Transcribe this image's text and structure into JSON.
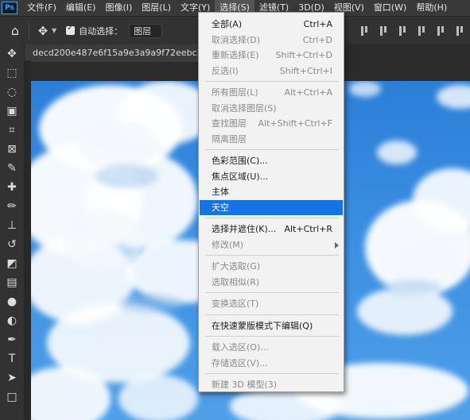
{
  "app": {
    "logo_text": "Ps"
  },
  "menubar": [
    {
      "label": "文件(F)"
    },
    {
      "label": "编辑(E)"
    },
    {
      "label": "图像(I)"
    },
    {
      "label": "图层(L)"
    },
    {
      "label": "文字(Y)"
    },
    {
      "label": "选择(S)"
    },
    {
      "label": "滤镜(T)"
    },
    {
      "label": "3D(D)"
    },
    {
      "label": "视图(V)"
    },
    {
      "label": "窗口(W)"
    },
    {
      "label": "帮助(H)"
    }
  ],
  "options": {
    "auto_select_label": "自动选择：",
    "auto_select_checked": true,
    "auto_select_target": "图层"
  },
  "document": {
    "tab_title": "decd200e487e6f15a9e3a9a9f72eebc5.jpg"
  },
  "select_menu": {
    "items": [
      {
        "label": "全部(A)",
        "shortcut": "Ctrl+A",
        "enabled": true
      },
      {
        "label": "取消选择(D)",
        "shortcut": "Ctrl+D",
        "enabled": false
      },
      {
        "label": "重新选择(E)",
        "shortcut": "Shift+Ctrl+D",
        "enabled": false
      },
      {
        "label": "反选(I)",
        "shortcut": "Shift+Ctrl+I",
        "enabled": false
      },
      {
        "label": "所有图层(L)",
        "shortcut": "Alt+Ctrl+A",
        "enabled": false
      },
      {
        "label": "取消选择图层(S)",
        "shortcut": "",
        "enabled": false
      },
      {
        "label": "查找图层",
        "shortcut": "Alt+Shift+Ctrl+F",
        "enabled": false
      },
      {
        "label": "隔离图层",
        "shortcut": "",
        "enabled": false
      },
      {
        "label": "色彩范围(C)...",
        "shortcut": "",
        "enabled": true
      },
      {
        "label": "焦点区域(U)...",
        "shortcut": "",
        "enabled": true
      },
      {
        "label": "主体",
        "shortcut": "",
        "enabled": true
      },
      {
        "label": "天空",
        "shortcut": "",
        "enabled": true,
        "highlighted": true
      },
      {
        "label": "选择并遮住(K)...",
        "shortcut": "Alt+Ctrl+R",
        "enabled": true
      },
      {
        "label": "修改(M)",
        "shortcut": "",
        "enabled": false,
        "submenu": true
      },
      {
        "label": "扩大选取(G)",
        "shortcut": "",
        "enabled": false
      },
      {
        "label": "选取相似(R)",
        "shortcut": "",
        "enabled": false
      },
      {
        "label": "变换选区(T)",
        "shortcut": "",
        "enabled": false
      },
      {
        "label": "在快速蒙版模式下编辑(Q)",
        "shortcut": "",
        "enabled": true
      },
      {
        "label": "载入选区(O)...",
        "shortcut": "",
        "enabled": false
      },
      {
        "label": "存储选区(V)...",
        "shortcut": "",
        "enabled": false
      },
      {
        "label": "新建 3D 模型(3)",
        "shortcut": "",
        "enabled": false
      }
    ]
  },
  "colors": {
    "menu_highlight": "#1473e6",
    "sky": "#3b8fe2",
    "app_bg": "#2b2b2b"
  },
  "tools": [
    {
      "name": "move-tool-icon"
    },
    {
      "name": "marquee-tool-icon"
    },
    {
      "name": "lasso-tool-icon"
    },
    {
      "name": "object-select-tool-icon"
    },
    {
      "name": "crop-tool-icon"
    },
    {
      "name": "frame-tool-icon"
    },
    {
      "name": "eyedropper-tool-icon"
    },
    {
      "name": "healing-brush-tool-icon"
    },
    {
      "name": "brush-tool-icon"
    },
    {
      "name": "clone-stamp-tool-icon"
    },
    {
      "name": "history-brush-tool-icon"
    },
    {
      "name": "eraser-tool-icon"
    },
    {
      "name": "gradient-tool-icon"
    },
    {
      "name": "blur-tool-icon"
    },
    {
      "name": "dodge-tool-icon"
    },
    {
      "name": "pen-tool-icon"
    },
    {
      "name": "type-tool-icon"
    },
    {
      "name": "path-select-tool-icon"
    },
    {
      "name": "rectangle-tool-icon"
    }
  ]
}
